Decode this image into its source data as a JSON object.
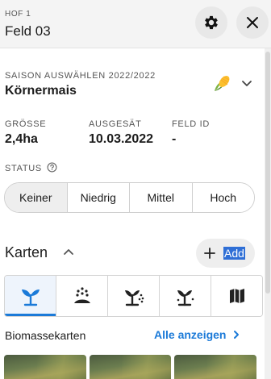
{
  "header": {
    "eyebrow": "HOF 1",
    "title": "Feld 03",
    "settings_icon": "gear-icon",
    "close_icon": "close-icon"
  },
  "season": {
    "label": "SAISON AUSWÄHLEN 2022/2022",
    "crop": "Körnermais",
    "crop_icon": "corn-icon"
  },
  "stats": [
    {
      "label": "GRÖSSE",
      "value": "2,4ha"
    },
    {
      "label": "AUSGESÄT",
      "value": "10.03.2022"
    },
    {
      "label": "FELD ID",
      "value": "-"
    }
  ],
  "status": {
    "label": "STATUS",
    "options": [
      "Keiner",
      "Niedrig",
      "Mittel",
      "Hoch"
    ],
    "selected": "Keiner"
  },
  "maps": {
    "title": "Karten",
    "add_label": "Add",
    "tabs": [
      {
        "icon": "seedling-icon",
        "active": true
      },
      {
        "icon": "seeding-icon",
        "active": false
      },
      {
        "icon": "plant-spray-icon",
        "active": false
      },
      {
        "icon": "plant-fertilize-icon",
        "active": false
      },
      {
        "icon": "map-icon",
        "active": false
      }
    ]
  },
  "biomass": {
    "title": "Biomassekarten",
    "show_all": "Alle anzeigen"
  },
  "colors": {
    "accent": "#1b7ad8",
    "header_bg": "#f4f4f4",
    "selection": "#2f6fd6"
  }
}
